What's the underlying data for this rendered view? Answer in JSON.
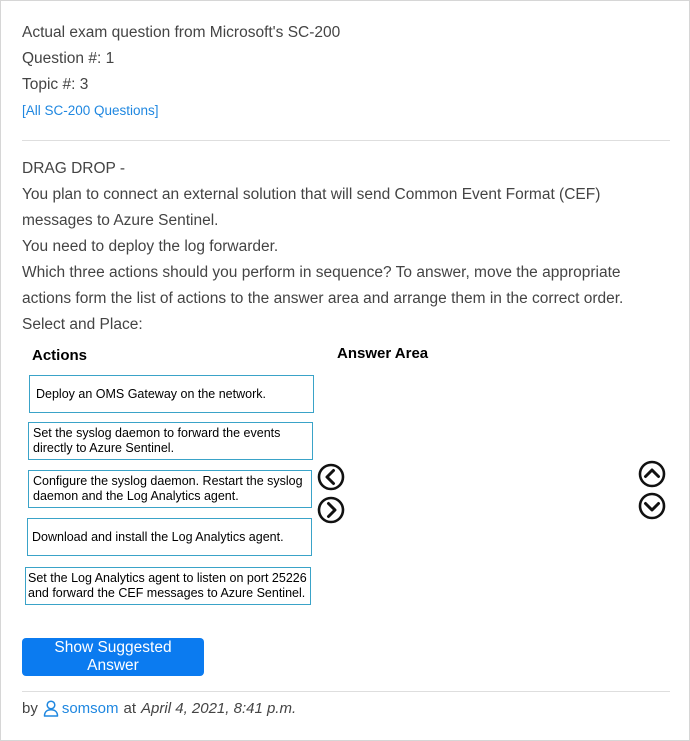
{
  "meta": {
    "exam_line": "Actual exam question from Microsoft's SC-200",
    "question_number": "Question #: 1",
    "topic": "Topic #: 3",
    "all_questions_link": "[All SC-200 Questions]"
  },
  "question": {
    "lines": [
      "DRAG DROP -",
      "You plan to connect an external solution that will send Common Event Format (CEF) messages to Azure Sentinel.",
      "You need to deploy the log forwarder.",
      "Which three actions should you perform in sequence? To answer, move the appropriate actions form the list of actions to the answer area and arrange them in the correct order.",
      "Select and Place:"
    ]
  },
  "exhibit": {
    "actions_title": "Actions",
    "answer_area_title": "Answer Area",
    "actions": [
      "Deploy an OMS Gateway on the network.",
      "Set the syslog daemon to forward the events directly to Azure Sentinel.",
      "Configure the syslog daemon. Restart the syslog daemon and the Log Analytics agent.",
      "Download and install the Log Analytics agent.",
      "Set the Log Analytics agent to listen on port 25226 and forward the CEF messages to Azure Sentinel."
    ],
    "controls": {
      "move_left_icon": "chevron-left-circle",
      "move_right_icon": "chevron-right-circle",
      "move_up_icon": "chevron-up-circle",
      "move_down_icon": "chevron-down-circle"
    }
  },
  "buttons": {
    "show_answer": "Show Suggested Answer"
  },
  "byline": {
    "by": "by",
    "user": "somsom",
    "at": "at",
    "date": "April 4, 2021, 8:41 p.m."
  },
  "colors": {
    "accent": "#0b7bf0",
    "link": "#1f87e0",
    "box_border": "#3aa3c8",
    "text": "#444444"
  }
}
